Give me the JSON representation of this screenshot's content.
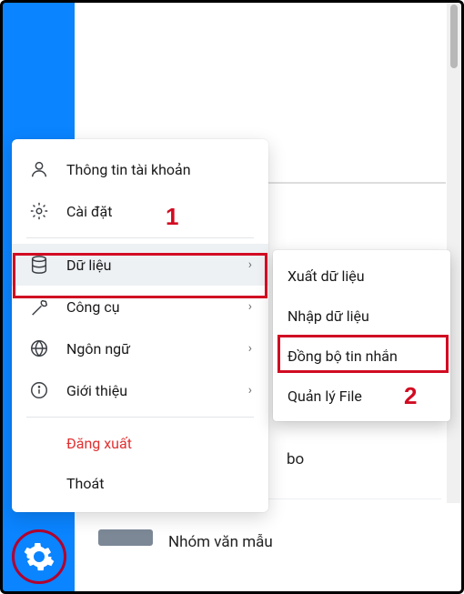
{
  "menu": {
    "account_info": "Thông tin tài khoản",
    "settings": "Cài đặt",
    "data": "Dữ liệu",
    "tools": "Công cụ",
    "language": "Ngôn ngữ",
    "about": "Giới thiệu",
    "logout": "Đăng xuất",
    "exit": "Thoát"
  },
  "submenu": {
    "export_data": "Xuất dữ liệu",
    "import_data": "Nhập dữ liệu",
    "sync_messages": "Đồng bộ tin nhắn",
    "file_manager": "Quản lý File"
  },
  "annotations": {
    "one": "1",
    "two": "2"
  },
  "background": {
    "partial_bo": "bo",
    "partial_name": "Nhóm văn mẫu"
  },
  "colors": {
    "primary": "#0a84ff",
    "highlight": "#d10c22"
  }
}
